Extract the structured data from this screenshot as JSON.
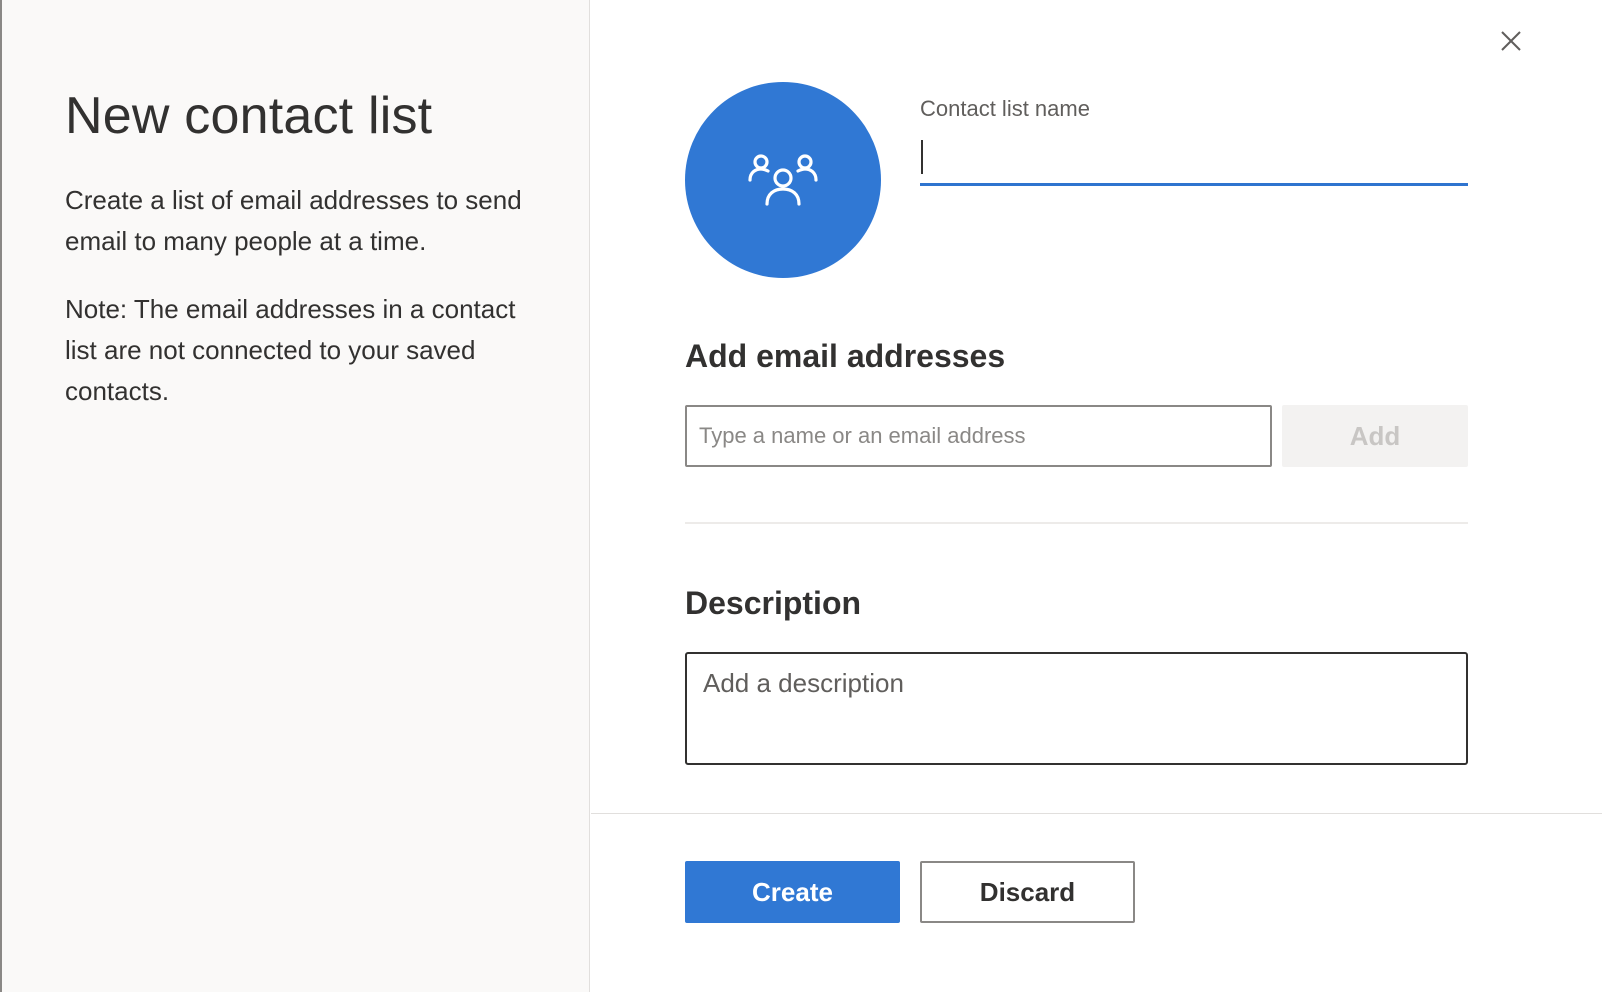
{
  "dialog": {
    "title": "New contact list",
    "intro": "Create a list of email addresses to send email to many people at a time.",
    "note": "Note: The email addresses in a contact list are not connected to your saved contacts."
  },
  "form": {
    "name_label": "Contact list name",
    "name_value": "",
    "email_heading": "Add email addresses",
    "email_placeholder": "Type a name or an email address",
    "add_label": "Add",
    "description_heading": "Description",
    "description_placeholder": "Add a description"
  },
  "footer": {
    "create_label": "Create",
    "discard_label": "Discard"
  },
  "icons": {
    "close": "close-icon",
    "avatar": "group-people-icon"
  },
  "colors": {
    "accent": "#3078d4",
    "left_panel_bg": "#faf9f8",
    "disabled_bg": "#f3f2f1"
  }
}
